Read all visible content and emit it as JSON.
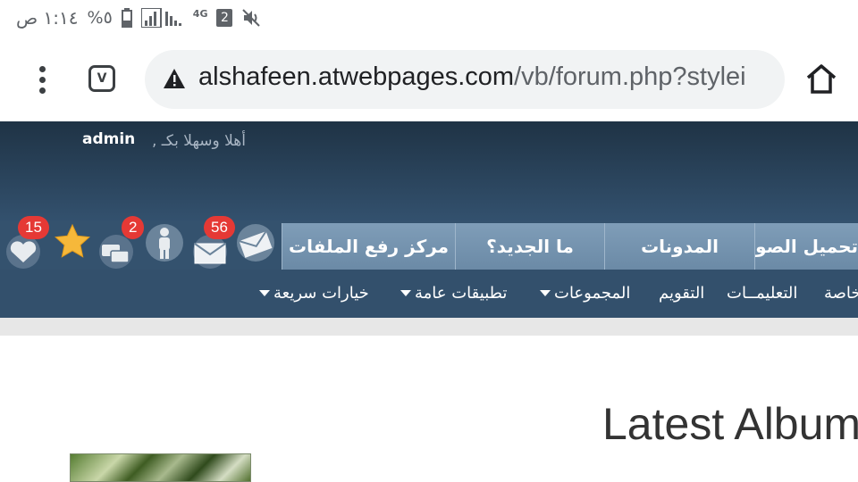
{
  "status_bar": {
    "time": "١:١٤ ص",
    "battery": "%٥",
    "network": "4G",
    "sim": "2"
  },
  "browser": {
    "url_host": "alshafeen.atwebpages.com",
    "url_path": "/vb/forum.php?stylei",
    "tab_count": "V"
  },
  "forum": {
    "welcome_prefix": "أهلا وسهلا بكـ ,",
    "username": "admin",
    "nav_tabs": [
      "مركز رفع الملفات",
      "ما الجديد؟",
      "المدونات",
      "تحميل الصور"
    ],
    "notifications": {
      "likes": "15",
      "messages": "2",
      "email": "56"
    },
    "subnav": [
      "خيارات سريعة",
      "تطبيقات عامة",
      "المجموعات",
      "التقويم",
      "التعليمــات",
      "خاصة"
    ]
  },
  "content": {
    "title": "Latest Albums"
  }
}
